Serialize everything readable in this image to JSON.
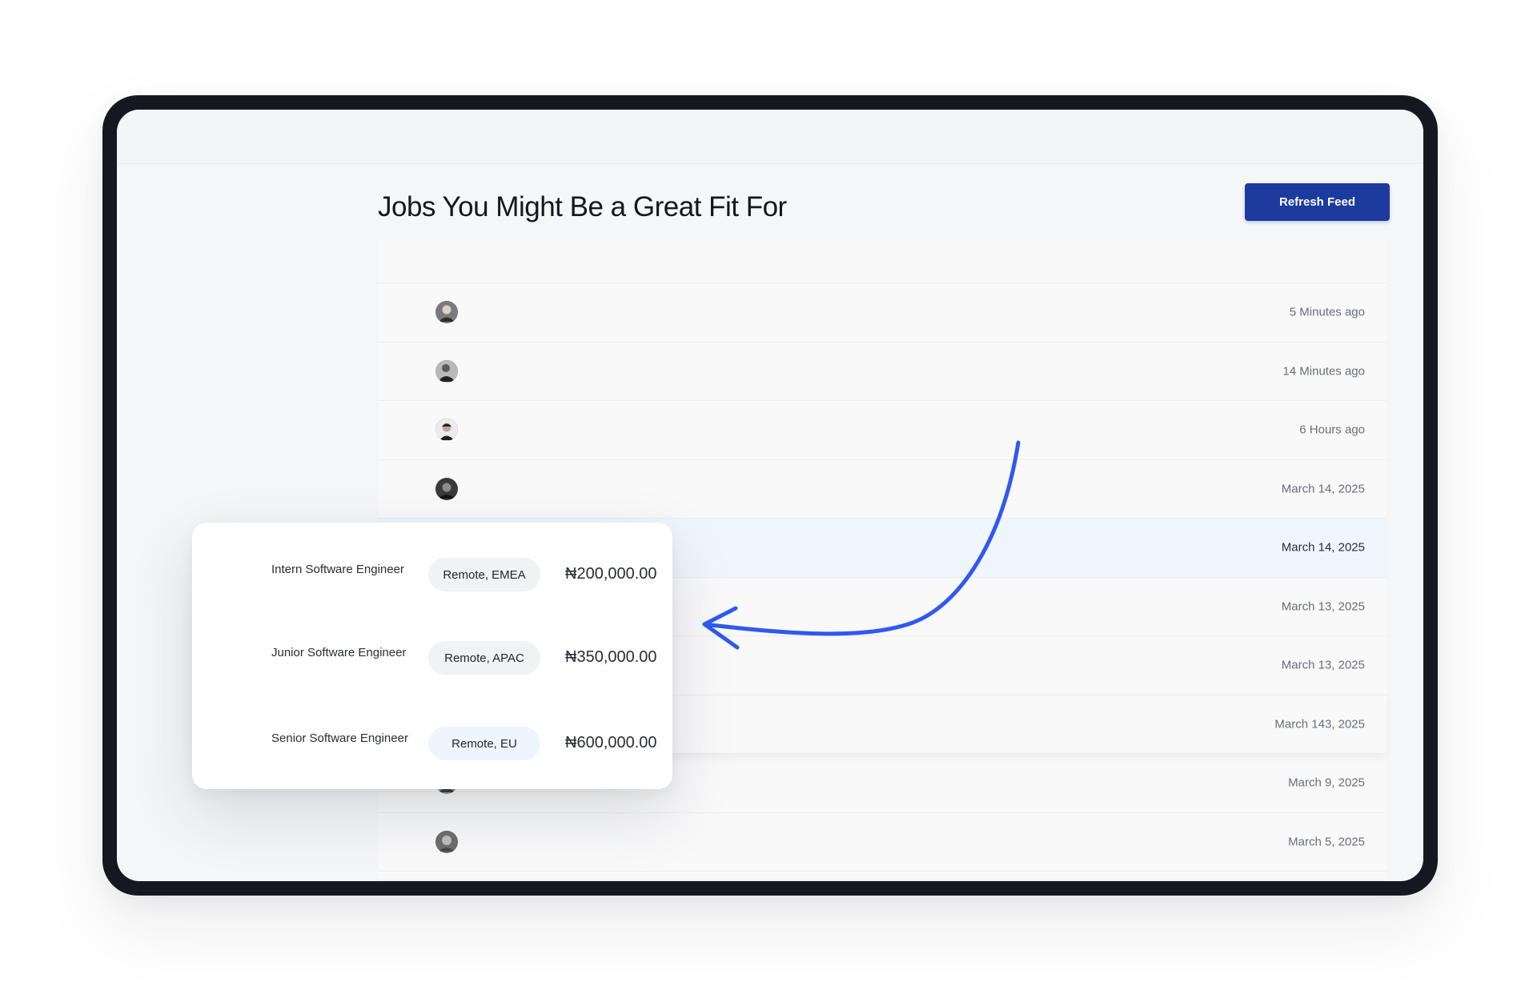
{
  "page": {
    "title": "Jobs You Might Be a Great Fit For",
    "refresh_label": "Refresh Feed"
  },
  "feed": {
    "rows": [
      {
        "time": "5 Minutes ago",
        "avatar": "avatar-portrait"
      },
      {
        "time": "14 Minutes ago",
        "avatar": "avatar-portrait"
      },
      {
        "time": "6 Hours ago",
        "avatar": "avatar-portrait"
      },
      {
        "time": "March 14, 2025",
        "avatar": "avatar-portrait"
      },
      {
        "time": "March 14, 2025",
        "avatar": "avatar-portrait",
        "highlighted": true
      },
      {
        "time": "March 13, 2025",
        "avatar": "avatar-portrait"
      },
      {
        "time": "March 13, 2025",
        "avatar": "avatar-portrait"
      },
      {
        "time": "March 143, 2025",
        "avatar": "avatar-portrait"
      },
      {
        "time": "March 9, 2025",
        "avatar": "avatar-portrait"
      },
      {
        "time": "March 5, 2025",
        "avatar": "avatar-portrait"
      }
    ]
  },
  "jobs_card": {
    "jobs": [
      {
        "title": "Intern Software Engineer",
        "location": "Remote, EMEA",
        "salary": "₦200,000.00"
      },
      {
        "title": "Junior Software Engineer",
        "location": "Remote, APAC",
        "salary": "₦350,000.00"
      },
      {
        "title": "Senior Software Engineer",
        "location": "Remote, EU",
        "salary": "₦600,000.00"
      }
    ]
  },
  "colors": {
    "device_frame": "#161821",
    "primary_button": "#1d3a9e",
    "arrow": "#2f59f2",
    "row_highlight": "#f0f6fe"
  }
}
